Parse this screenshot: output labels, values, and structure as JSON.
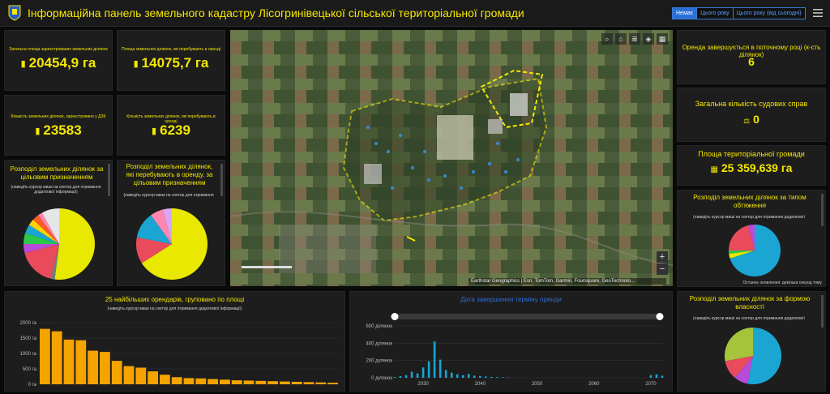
{
  "header": {
    "title": "Інформаційна панель земельного кадастру Лісогринівецької сільської територіальної громади",
    "tabs": [
      {
        "label": "Немає",
        "active": true
      },
      {
        "label": "Цього року",
        "active": false
      },
      {
        "label": "Цього року (від сьогодні)",
        "active": false
      }
    ]
  },
  "kpis": [
    {
      "label": "Загальна площа зареєстрованих земельних ділянок",
      "value": "20454,9 га",
      "icon": "land-icon"
    },
    {
      "label": "Площа земельних ділянок, які перебувають в оренді",
      "value": "14075,7 га",
      "icon": "land-icon"
    },
    {
      "label": "Кількість земельних ділянок, зареєстровано у ДЗК",
      "value": "23583",
      "icon": "land-icon"
    },
    {
      "label": "Кількість земельних ділянок, які перебувають в оренді",
      "value": "6239",
      "icon": "land-icon"
    }
  ],
  "right_kpis": [
    {
      "label": "Оренда завершується в поточному році (к-сть ділянок)",
      "value": "6"
    },
    {
      "label": "Загальна кількість судових справ",
      "value": "0",
      "icon": "court-icon"
    },
    {
      "label": "Площа територіальної громади",
      "value": "25 359,639 га",
      "icon": "map-icon"
    }
  ],
  "pies": {
    "purpose": {
      "title": "Розподіл земельних ділянок за цільовим призначенням",
      "hint": "(наведіть курсор миші на сектор для отримання додаткової інформації)",
      "slices": [
        {
          "value": 52,
          "color": "#e8e800"
        },
        {
          "value": 2,
          "color": "#7a7a7a"
        },
        {
          "value": 17,
          "color": "#ea4b5c"
        },
        {
          "value": 4,
          "color": "#b84bd8"
        },
        {
          "value": 5,
          "color": "#2bc84a"
        },
        {
          "value": 4,
          "color": "#1aa5d3"
        },
        {
          "value": 3,
          "color": "#ffd200"
        },
        {
          "value": 3,
          "color": "#ff5a1f"
        },
        {
          "value": 2,
          "color": "#ff86b0"
        },
        {
          "value": 8,
          "color": "#e6e6e6"
        }
      ]
    },
    "lease_purpose": {
      "title": "Розподіл земельних ділянок, які перебувають в оренду, за цільовим призначенням",
      "hint": "(наведіть курсор миші на сектор для отримання",
      "slices": [
        {
          "value": 66,
          "color": "#e8e800"
        },
        {
          "value": 12,
          "color": "#ea4b5c"
        },
        {
          "value": 12,
          "color": "#1aa5d3"
        },
        {
          "value": 6,
          "color": "#ff86b0"
        },
        {
          "value": 4,
          "color": "#d9a6f5"
        }
      ]
    },
    "encumbrance": {
      "title": "Розподіл земельних ділянок за типом обтяження",
      "hint": "(наведіть курсор миші на сектор для отримання додаткової",
      "last_update": "Останнє оновлення: декілька секунд тому",
      "slices": [
        {
          "value": 70,
          "color": "#1aa5d3"
        },
        {
          "value": 3,
          "color": "#e8e800"
        },
        {
          "value": 2,
          "color": "#2bc84a"
        },
        {
          "value": 21,
          "color": "#ea4b5c"
        },
        {
          "value": 4,
          "color": "#b84bd8"
        }
      ]
    },
    "ownership": {
      "title": "Розподіл земельних ділянок за формою власності",
      "hint": "(наведіть курсор миші на сектор для отримання додаткової",
      "slices": [
        {
          "value": 53,
          "color": "#1aa5d3"
        },
        {
          "value": 8,
          "color": "#b84bd8"
        },
        {
          "value": 11,
          "color": "#ea4b5c"
        },
        {
          "value": 28,
          "color": "#a6c43a"
        }
      ]
    }
  },
  "chart_data": [
    {
      "type": "bar",
      "title": "25 найбільших орендарів, груповано по площі",
      "subtitle": "(наведіть курсор миші на сектор для отримання додаткової інформації)",
      "categories": [
        "1",
        "2",
        "3",
        "4",
        "5",
        "6",
        "7",
        "8",
        "9",
        "10",
        "11",
        "12",
        "13",
        "14",
        "15",
        "16",
        "17",
        "18",
        "19",
        "20",
        "21",
        "22",
        "23",
        "24",
        "25"
      ],
      "values": [
        1800,
        1720,
        1450,
        1430,
        1090,
        1050,
        760,
        590,
        540,
        420,
        310,
        230,
        200,
        190,
        170,
        150,
        130,
        120,
        110,
        100,
        90,
        80,
        70,
        60,
        50
      ],
      "yticks": [
        "0 га",
        "500 га",
        "1000 га",
        "1500 га",
        "2000 га"
      ],
      "ylim": [
        0,
        2000
      ],
      "color": "#f5a300"
    },
    {
      "type": "area",
      "title": "Дата завершення терміну оренди",
      "yticks": [
        "0 ділянок",
        "200 ділянок",
        "400 ділянок",
        "600 ділянок"
      ],
      "xticks": [
        "2030",
        "2040",
        "2050",
        "2060",
        "2070"
      ],
      "ylim": [
        0,
        600
      ],
      "xlim": [
        2025,
        2072
      ],
      "x": [
        2025,
        2026,
        2027,
        2028,
        2029,
        2030,
        2031,
        2032,
        2033,
        2034,
        2035,
        2036,
        2037,
        2038,
        2039,
        2040,
        2041,
        2042,
        2043,
        2044,
        2045,
        2070,
        2071,
        2072
      ],
      "values": [
        10,
        20,
        30,
        70,
        50,
        120,
        190,
        420,
        210,
        90,
        60,
        40,
        30,
        45,
        25,
        20,
        15,
        10,
        8,
        6,
        4,
        30,
        40,
        25
      ],
      "color": "#1aa5d3"
    }
  ],
  "map": {
    "attribution": "Earthstar Geographics | Esri, TomTom, Garmin, Foursquare, GeoTechnolo..."
  }
}
